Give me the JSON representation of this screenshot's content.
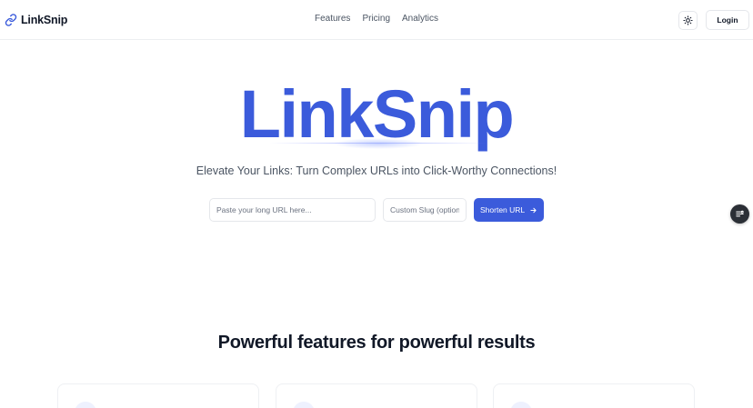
{
  "header": {
    "brand": "LinkSnip",
    "nav": [
      {
        "label": "Features"
      },
      {
        "label": "Pricing"
      },
      {
        "label": "Analytics"
      }
    ],
    "login_label": "Login",
    "theme_icon": "sun-icon"
  },
  "hero": {
    "title": "LinkSnip",
    "tagline": "Elevate Your Links: Turn Complex URLs into Click-Worthy Connections!",
    "url_placeholder": "Paste your long URL here...",
    "url_value": "",
    "slug_placeholder": "Custom Slug (optional)",
    "slug_value": "",
    "shorten_label": "Shorten URL",
    "shorten_icon": "arrow-right-icon"
  },
  "features": {
    "title": "Powerful features for powerful results"
  },
  "colors": {
    "brand": "#3b5bdb",
    "text": "#111827",
    "muted": "#4b5563",
    "border": "#e5e7eb"
  }
}
